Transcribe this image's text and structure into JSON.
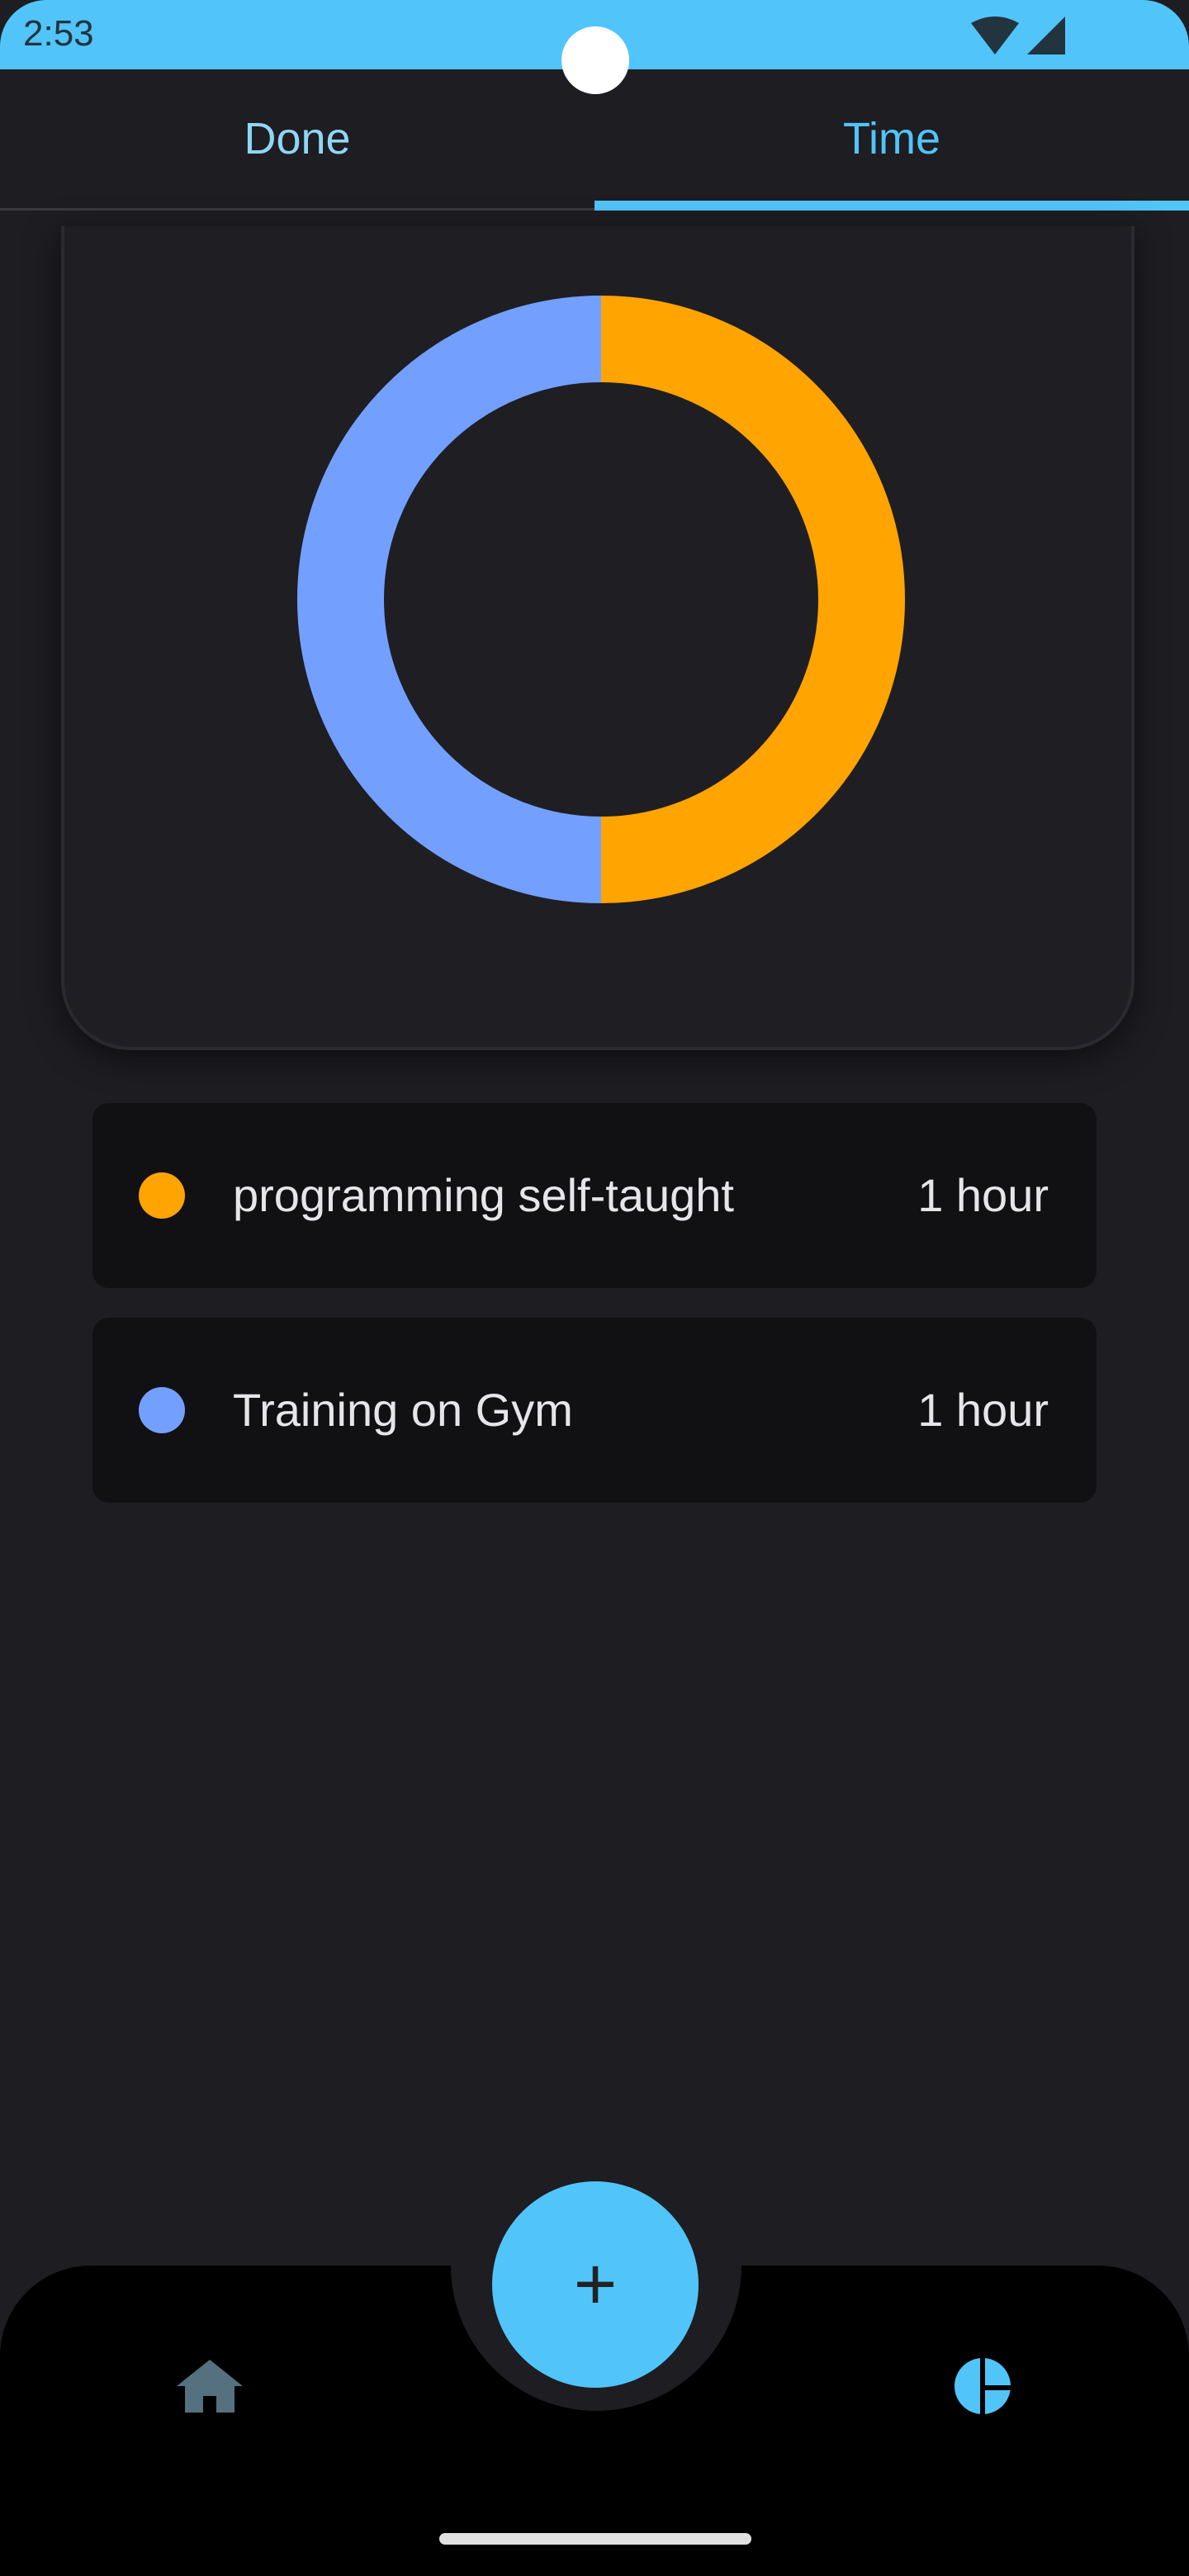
{
  "status_bar": {
    "time": "2:53"
  },
  "tabs": [
    {
      "label": "Done"
    },
    {
      "label": "Time",
      "active": true
    }
  ],
  "chart_data": {
    "type": "pie",
    "style": "donut",
    "labels": [
      "programming self-taught",
      "Training on Gym"
    ],
    "values": [
      1,
      1
    ],
    "colors": [
      "#ffa400",
      "#73a0ff"
    ]
  },
  "items": [
    {
      "label": "programming self-taught",
      "value": "1 hour",
      "color": "#ffa400"
    },
    {
      "label": "Training on Gym",
      "value": "1 hour",
      "color": "#73a0ff"
    }
  ],
  "fab": {
    "icon": "plus-icon",
    "label": "+"
  },
  "bottom_nav": [
    {
      "icon": "home-icon"
    },
    {
      "icon": "pie-chart-icon"
    }
  ],
  "colors": {
    "accent": "#51c5f9",
    "background": "#1e1d22",
    "card": "#111114"
  }
}
